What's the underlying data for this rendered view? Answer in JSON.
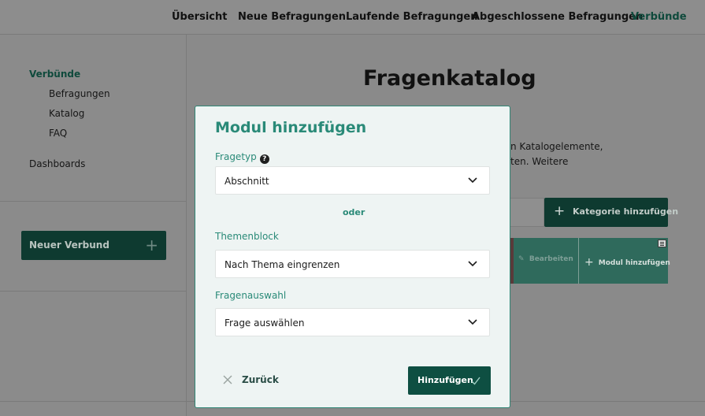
{
  "topnav": {
    "items": [
      "Übersicht",
      "Neue Befragungen",
      "Laufende Befragungen",
      "Abgeschlossene Befragungen",
      "Verbünde"
    ],
    "active": "Verbünde"
  },
  "sidebar": {
    "section_title": "Verbünde",
    "sub_items": [
      "Befragungen",
      "Katalog",
      "FAQ"
    ],
    "dashboards": "Dashboards",
    "new_button": "Neuer Verbund",
    "new_button_icon": "plus-icon"
  },
  "main": {
    "title": "Fragenkatalog",
    "desc_line1": "n Katalogelemente,",
    "desc_line2": "ten. Weitere",
    "add_category": "Kategorie hinzufügen",
    "row_edit": "Bearbeiten",
    "row_add_module": "Modul hinzufügen"
  },
  "modal": {
    "title": "Modul hinzufügen",
    "fragetyp_label": "Fragetyp",
    "help_glyph": "?",
    "fragetyp_value": "Abschnitt",
    "oder": "oder",
    "themenblock_label": "Themenblock",
    "themenblock_value": "Nach Thema eingrenzen",
    "fragenauswahl_label": "Fragenauswahl",
    "fragenauswahl_value": "Frage auswählen",
    "back_label": "Zurück",
    "submit_label": "Hinzufügen"
  },
  "colors": {
    "accent": "#2a8a78",
    "dark_green": "#0e4f42",
    "modal_bg": "#eef4f3"
  }
}
